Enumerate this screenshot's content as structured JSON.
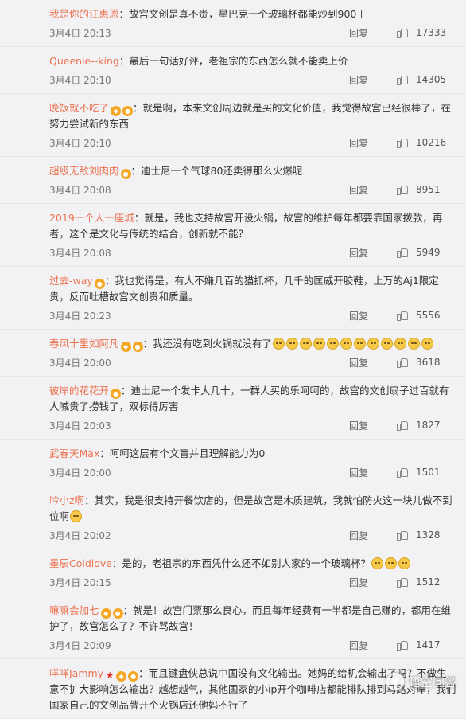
{
  "labels": {
    "reply": "回复"
  },
  "watermark": {
    "text": "悟空问答"
  },
  "comments": [
    {
      "user": "我是你的江惠恩",
      "badges": [],
      "text": "：故宫文创是真不贵，星巴克一个玻璃杯都能炒到900＋",
      "emoji_count": 0,
      "date": "3月4日 20:13",
      "likes": "17333"
    },
    {
      "user": "Queenie--king",
      "badges": [],
      "text": "：最后一句话好评，老祖宗的东西怎么就不能卖上价",
      "emoji_count": 0,
      "date": "3月4日 20:10",
      "likes": "14305"
    },
    {
      "user": "晚饭就不吃了",
      "badges": [
        "vip",
        "v"
      ],
      "text": "：就是啊，本来文创周边就是买的文化价值，我觉得故宫已经很棒了，在努力尝试新的东西",
      "emoji_count": 0,
      "date": "3月4日 20:10",
      "likes": "10216"
    },
    {
      "user": "超级无敌刘肉肉",
      "badges": [
        "v"
      ],
      "text": "：迪士尼一个气球80还卖得那么火爆呢",
      "emoji_count": 0,
      "date": "3月4日 20:08",
      "likes": "8951"
    },
    {
      "user": "2019一个人一座城",
      "badges": [],
      "text": "：就是，我也支持故宫开设火锅，故宫的维护每年都要靠国家拨款，再者，这个是文化与传统的结合，创新就不能？",
      "emoji_count": 0,
      "date": "3月4日 20:08",
      "likes": "5949"
    },
    {
      "user": "过去-way",
      "badges": [
        "v"
      ],
      "text": "：我也觉得是，有人不嫌几百的猫抓杯，几千的匡威开胶鞋，上万的Aj1限定贵，反而吐槽故宫文创贵和质量。",
      "emoji_count": 0,
      "date": "3月4日 20:23",
      "likes": "5556"
    },
    {
      "user": "春风十里如阿凡",
      "badges": [
        "vip",
        "v"
      ],
      "text": "：我还没有吃到火锅就没有了",
      "emoji_count": 12,
      "date": "3月4日 20:00",
      "likes": "3618"
    },
    {
      "user": "彼岸的花花开",
      "badges": [
        "v"
      ],
      "text": "：迪士尼一个发卡大几十，一群人买的乐呵呵的，故宫的文创扇子过百就有人喊贵了捞钱了，双标得厉害",
      "emoji_count": 0,
      "date": "3月4日 20:03",
      "likes": "1827"
    },
    {
      "user": "武春天Max",
      "badges": [],
      "text": "：呵呵这层有个文盲并且理解能力为0",
      "emoji_count": 0,
      "date": "3月4日 20:00",
      "likes": "1501"
    },
    {
      "user": "吟小z啊",
      "badges": [],
      "text": "：其实，我是很支持开餐饮店的，但是故宫是木质建筑，我就怕防火这一块儿做不到位啊",
      "emoji_count": 1,
      "date": "3月4日 20:02",
      "likes": "1328"
    },
    {
      "user": "墨辰Coldlove",
      "badges": [],
      "text": "：是的，老祖宗的东西凭什么还不如别人家的一个玻璃杯？",
      "emoji_count": 3,
      "date": "3月4日 20:15",
      "likes": "1512"
    },
    {
      "user": "嘛嘛会加七",
      "badges": [
        "vip",
        "v"
      ],
      "text": "：就是！故宫门票那么良心，而且每年经费有一半都是自己赚的，都用在维护了，故宫怎么了？不许骂故宫！",
      "emoji_count": 0,
      "date": "3月4日 20:09",
      "likes": "1417"
    },
    {
      "user": "咩咩Jammy",
      "badges": [
        "star",
        "vip",
        "v"
      ],
      "text": "：而且键盘侠总说中国没有文化输出。她妈的给机会输出了吗？不做生意不扩大影响怎么输出？越想越气，其他国家的小ip开个咖啡店都能排队排到马路对岸，我们国家自己的文创品牌开个火锅店还他妈不行了",
      "emoji_count": 0,
      "date": "",
      "likes": ""
    }
  ]
}
